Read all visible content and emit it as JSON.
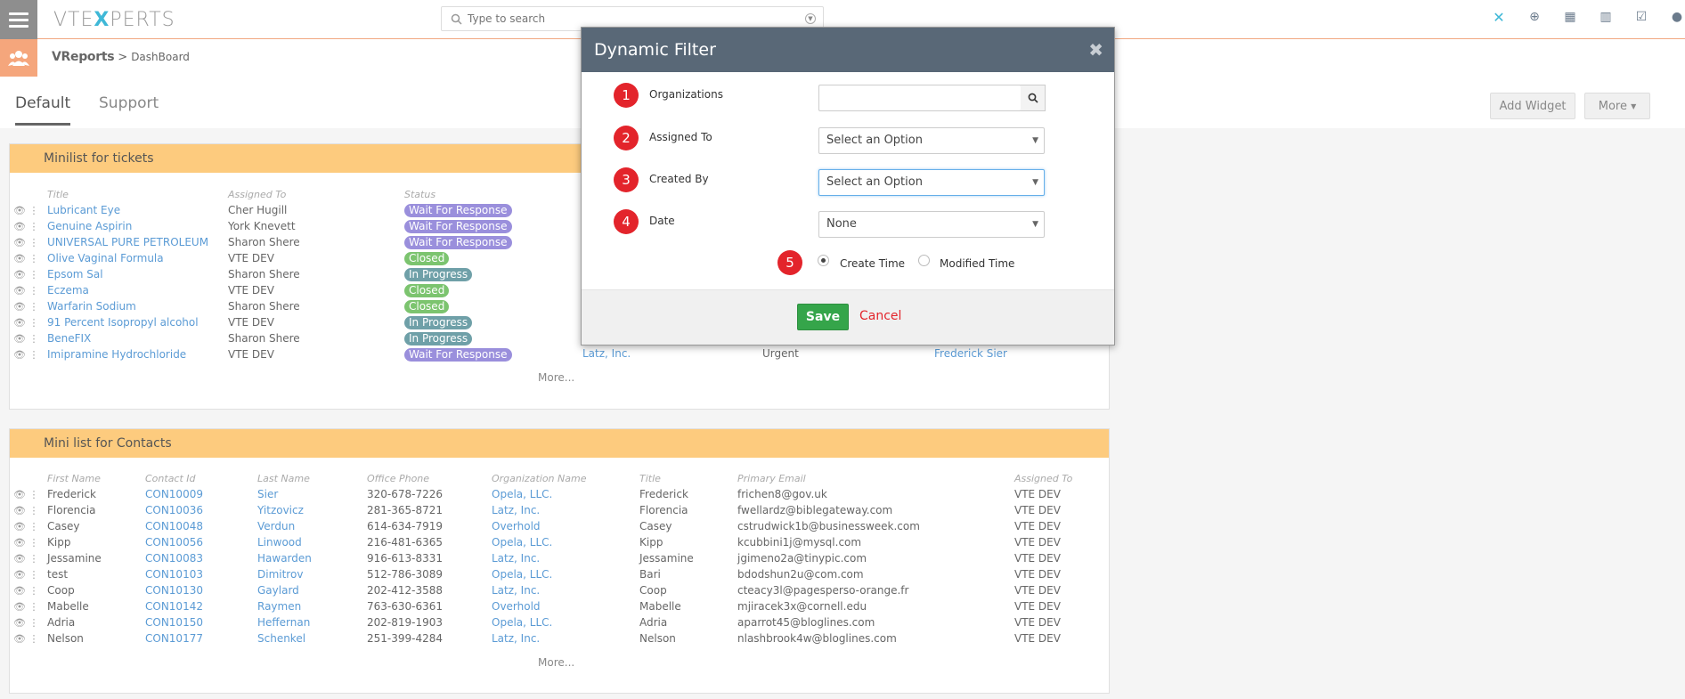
{
  "header": {
    "logo_prefix": "VTE",
    "logo_x": "X",
    "logo_suffix": "PERTS",
    "search_placeholder": "Type to search"
  },
  "breadcrumb": {
    "module": "VReports",
    "separator": ">",
    "current": "DashBoard"
  },
  "tabs": [
    {
      "label": "Default",
      "active": true
    },
    {
      "label": "Support",
      "active": false
    }
  ],
  "toolbar": {
    "add_widget": "Add Widget",
    "more": "More"
  },
  "tickets_widget": {
    "title": "Minilist for tickets",
    "columns": [
      "Title",
      "Assigned To",
      "Status"
    ],
    "rows": [
      {
        "title": "Lubricant Eye",
        "assigned": "Cher Hugill",
        "status": "Wait For Response"
      },
      {
        "title": "Genuine Aspirin",
        "assigned": "York Knevett",
        "status": "Wait For Response"
      },
      {
        "title": "UNIVERSAL PURE PETROLEUM",
        "assigned": "Sharon Shere",
        "status": "Wait For Response"
      },
      {
        "title": "Olive Vaginal Formula",
        "assigned": "VTE DEV",
        "status": "Closed"
      },
      {
        "title": "Epsom Sal",
        "assigned": "Sharon Shere",
        "status": "In Progress"
      },
      {
        "title": "Eczema",
        "assigned": "VTE DEV",
        "status": "Closed"
      },
      {
        "title": "Warfarin Sodium",
        "assigned": "Sharon Shere",
        "status": "Closed"
      },
      {
        "title": "91 Percent Isopropyl alcohol",
        "assigned": "VTE DEV",
        "status": "In Progress"
      },
      {
        "title": "BeneFIX",
        "assigned": "Sharon Shere",
        "status": "In Progress"
      },
      {
        "title": "Imipramine Hydrochloride",
        "assigned": "VTE DEV",
        "status": "Wait For Response"
      }
    ],
    "last_row_extra": {
      "organization": "Latz, Inc.",
      "priority": "Urgent",
      "contact": "Frederick Sier"
    },
    "more": "More..."
  },
  "contacts_widget": {
    "title": "Mini list for Contacts",
    "columns": [
      "First Name",
      "Contact Id",
      "Last Name",
      "Office Phone",
      "Organization Name",
      "Title",
      "Primary Email",
      "Assigned To"
    ],
    "rows": [
      [
        "Frederick",
        "CON10009",
        "Sier",
        "320-678-7226",
        "Opela, LLC.",
        "Frederick",
        "frichen8@gov.uk",
        "VTE DEV"
      ],
      [
        "Florencia",
        "CON10036",
        "Yitzovicz",
        "281-365-8721",
        "Latz, Inc.",
        "Florencia",
        "fwellardz@biblegateway.com",
        "VTE DEV"
      ],
      [
        "Casey",
        "CON10048",
        "Verdun",
        "614-634-7919",
        "Overhold",
        "Casey",
        "cstrudwick1b@businessweek.com",
        "VTE DEV"
      ],
      [
        "Kipp",
        "CON10056",
        "Linwood",
        "216-481-6365",
        "Opela, LLC.",
        "Kipp",
        "kcubbini1j@mysql.com",
        "VTE DEV"
      ],
      [
        "Jessamine",
        "CON10083",
        "Hawarden",
        "916-613-8331",
        "Latz, Inc.",
        "Jessamine",
        "jgimeno2a@tinypic.com",
        "VTE DEV"
      ],
      [
        "test",
        "CON10103",
        "Dimitrov",
        "512-786-3089",
        "Opela, LLC.",
        "Bari",
        "bdodshun2u@com.com",
        "VTE DEV"
      ],
      [
        "Coop",
        "CON10130",
        "Gaylard",
        "202-412-3588",
        "Latz, Inc.",
        "Coop",
        "cteacy3l@pagesperso-orange.fr",
        "VTE DEV"
      ],
      [
        "Mabelle",
        "CON10142",
        "Raymen",
        "763-630-6361",
        "Overhold",
        "Mabelle",
        "mjiracek3x@cornell.edu",
        "VTE DEV"
      ],
      [
        "Adria",
        "CON10150",
        "Heffernan",
        "202-819-1903",
        "Opela, LLC.",
        "Adria",
        "aparrot45@bloglines.com",
        "VTE DEV"
      ],
      [
        "Nelson",
        "CON10177",
        "Schenkel",
        "251-399-4284",
        "Latz, Inc.",
        "Nelson",
        "nlashbrook4w@bloglines.com",
        "VTE DEV"
      ]
    ],
    "more": "More..."
  },
  "status_colors": {
    "Wait For Response": "#9a8fdc",
    "Closed": "#7cc46f",
    "In Progress": "#6fa0a8"
  },
  "modal": {
    "title": "Dynamic Filter",
    "close": "✖",
    "fields": [
      {
        "num": "1",
        "label": "Organizations",
        "type": "lookup",
        "value": ""
      },
      {
        "num": "2",
        "label": "Assigned To",
        "type": "select",
        "value": "Select an Option"
      },
      {
        "num": "3",
        "label": "Created By",
        "type": "select",
        "value": "Select an Option"
      },
      {
        "num": "4",
        "label": "Date",
        "type": "select",
        "value": "None"
      }
    ],
    "radio_num": "5",
    "radio_options": [
      {
        "label": "Create Time",
        "checked": true
      },
      {
        "label": "Modified Time",
        "checked": false
      }
    ],
    "save": "Save",
    "cancel": "Cancel"
  }
}
